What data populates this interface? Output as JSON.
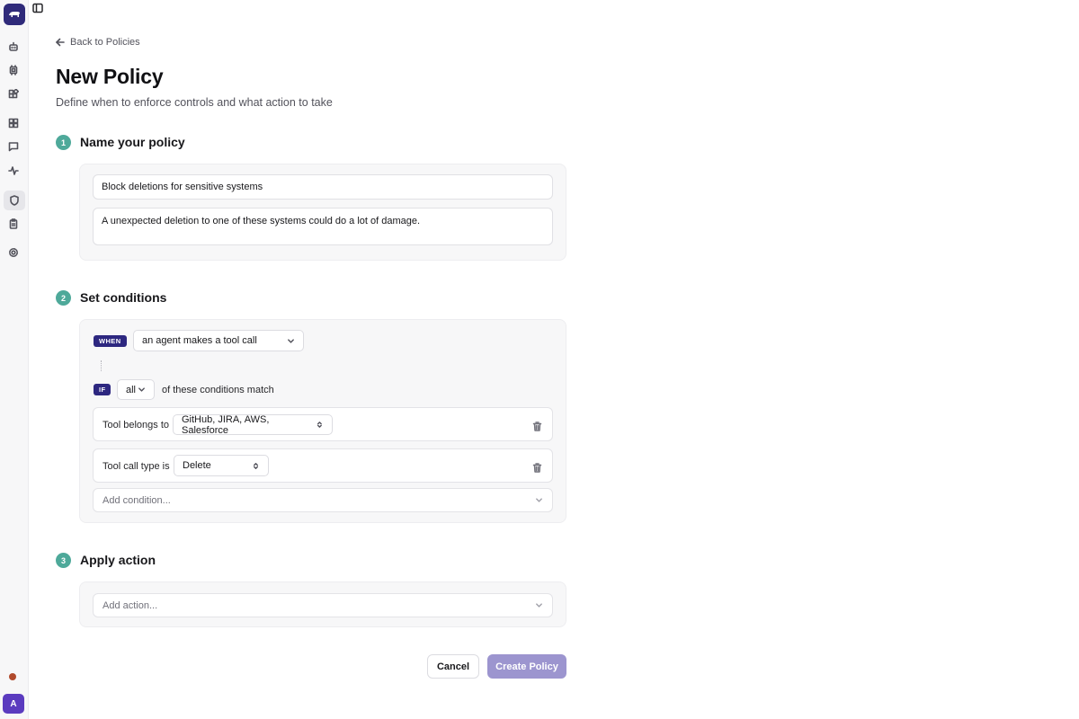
{
  "sidebar": {
    "logo_icon": "brand-logo-icon",
    "items": [
      {
        "icon": "robot-icon"
      },
      {
        "icon": "cpu-icon"
      },
      {
        "icon": "integrations-icon"
      },
      {
        "icon": "dashboard-icon"
      },
      {
        "icon": "chat-icon"
      },
      {
        "icon": "activity-icon"
      },
      {
        "icon": "shield-icon",
        "active": true
      },
      {
        "icon": "clipboard-icon"
      },
      {
        "icon": "gear-icon"
      }
    ],
    "avatar_initial": "A"
  },
  "header": {
    "back_label": "Back to Policies",
    "title": "New Policy",
    "subtitle": "Define when to enforce controls and what action to take"
  },
  "step1": {
    "number": "1",
    "title": "Name your policy",
    "name_value": "Block deletions for sensitive systems",
    "description_value": "A unexpected deletion to one of these systems could do a lot of damage."
  },
  "step2": {
    "number": "2",
    "title": "Set conditions",
    "when_tag": "WHEN",
    "trigger_value": "an agent makes a tool call",
    "if_tag": "IF",
    "match_value": "all",
    "match_suffix": "of these conditions match",
    "conditions": [
      {
        "label": "Tool belongs to",
        "value": "GitHub, JIRA, AWS, Salesforce"
      },
      {
        "label": "Tool call type is",
        "value": "Delete"
      }
    ],
    "add_condition_placeholder": "Add condition..."
  },
  "step3": {
    "number": "3",
    "title": "Apply action",
    "add_action_placeholder": "Add action..."
  },
  "footer": {
    "cancel_label": "Cancel",
    "create_label": "Create Policy"
  },
  "colors": {
    "brand": "#2f2a7a",
    "step_badge": "#4ea99a",
    "tag": "#2d2780",
    "primary_button_disabled": "#9c95cf",
    "avatar": "#5b3bbf",
    "status_dot": "#b04a2c"
  }
}
